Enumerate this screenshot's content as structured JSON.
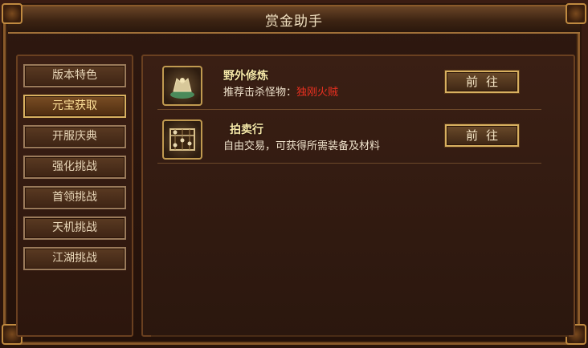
{
  "window": {
    "title": "赏金助手"
  },
  "nav": {
    "items": [
      {
        "label": "版本特色",
        "active": false
      },
      {
        "label": "元宝获取",
        "active": true
      },
      {
        "label": "开服庆典",
        "active": false
      },
      {
        "label": "强化挑战",
        "active": false
      },
      {
        "label": "首领挑战",
        "active": false
      },
      {
        "label": "天机挑战",
        "active": false
      },
      {
        "label": "江湖挑战",
        "active": false
      }
    ]
  },
  "rows": [
    {
      "name": "野外修炼",
      "desc_prefix": "推荐击杀怪物：",
      "desc_target": "独刚火贼",
      "button": "前往",
      "icon": "treasure-icon"
    },
    {
      "name": "拍卖行",
      "desc_prefix": "自由交易，可获得所需装备及材料",
      "desc_target": "",
      "button": "前往",
      "icon": "abacus-icon"
    }
  ],
  "colors": {
    "active_text": "#ffe29a",
    "target_text": "#e83020",
    "gold_border": "#d8b060"
  }
}
